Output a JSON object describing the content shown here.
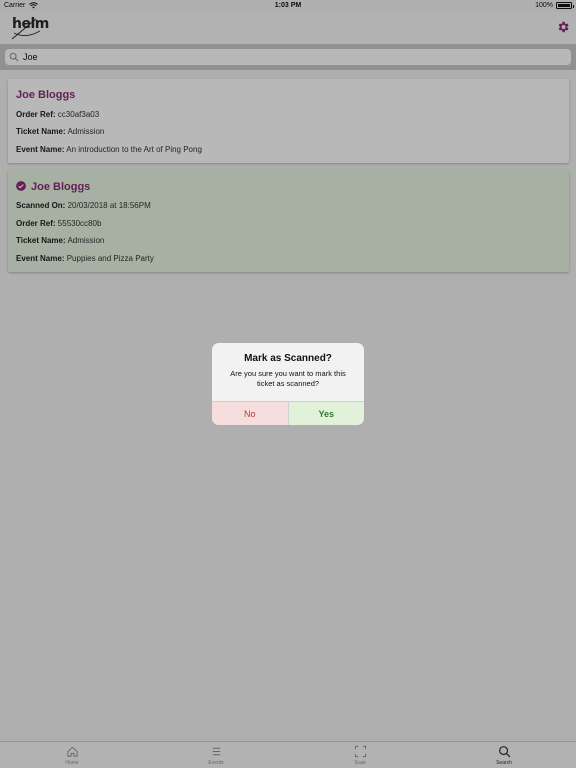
{
  "status_bar": {
    "carrier": "Carrier",
    "time": "1:03 PM",
    "battery": "100%"
  },
  "nav": {
    "logo_text": "helm",
    "settings_icon": "gear-icon"
  },
  "search": {
    "value": "Joe",
    "icon": "search-icon"
  },
  "results": [
    {
      "name": "Joe Bloggs",
      "scanned": false,
      "fields": [
        {
          "label": "Order Ref:",
          "value": "cc30af3a03"
        },
        {
          "label": "Ticket Name:",
          "value": "Admission"
        },
        {
          "label": "Event Name:",
          "value": "An introduction to the Art of Ping Pong"
        }
      ]
    },
    {
      "name": "Joe Bloggs",
      "scanned": true,
      "fields": [
        {
          "label": "Scanned On:",
          "value": "20/03/2018 at 18:56PM"
        },
        {
          "label": "Order Ref:",
          "value": "55530cc80b"
        },
        {
          "label": "Ticket Name:",
          "value": "Admission"
        },
        {
          "label": "Event Name:",
          "value": "Puppies and Pizza Party"
        }
      ]
    }
  ],
  "alert": {
    "title": "Mark as Scanned?",
    "message": "Are you sure you want to mark this ticket as scanned?",
    "no_label": "No",
    "yes_label": "Yes"
  },
  "tab_bar": {
    "tabs": [
      {
        "label": "Home",
        "icon": "home-icon",
        "active": false
      },
      {
        "label": "Events",
        "icon": "list-icon",
        "active": false
      },
      {
        "label": "Scan",
        "icon": "scan-icon",
        "active": false
      },
      {
        "label": "Search",
        "icon": "search-icon",
        "active": true
      }
    ]
  },
  "colors": {
    "accent": "#8a2f78",
    "scanned_bg": "#e8f5e2",
    "no_bg": "#f6dede",
    "yes_bg": "#e2f1da"
  }
}
